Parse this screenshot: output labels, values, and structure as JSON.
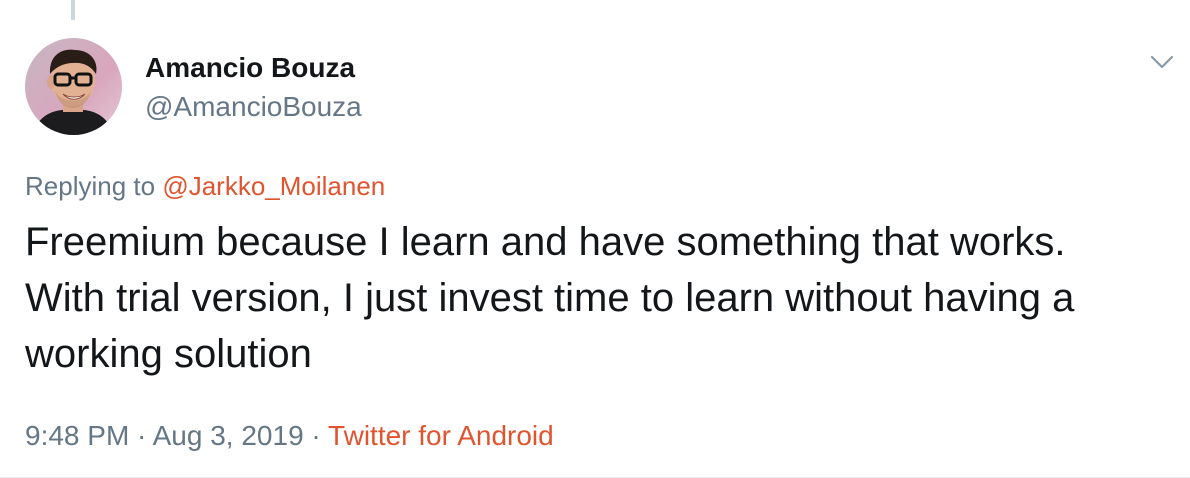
{
  "tweet": {
    "author": {
      "name": "Amancio Bouza",
      "handle": "@AmancioBouza"
    },
    "replying_prefix": "Replying to ",
    "replying_to": "@Jarkko_Moilanen",
    "text": "Freemium because I learn and have something that works.\nWith trial version, I just invest time to learn without having a\nworking solution",
    "time": "9:48 PM",
    "separator": " · ",
    "date": "Aug 3, 2019",
    "source": "Twitter for Android"
  },
  "icons": {
    "more": "chevron-down-icon"
  },
  "colors": {
    "link": "#e0552f",
    "secondary_text": "#657786",
    "primary_text": "#14171a"
  }
}
